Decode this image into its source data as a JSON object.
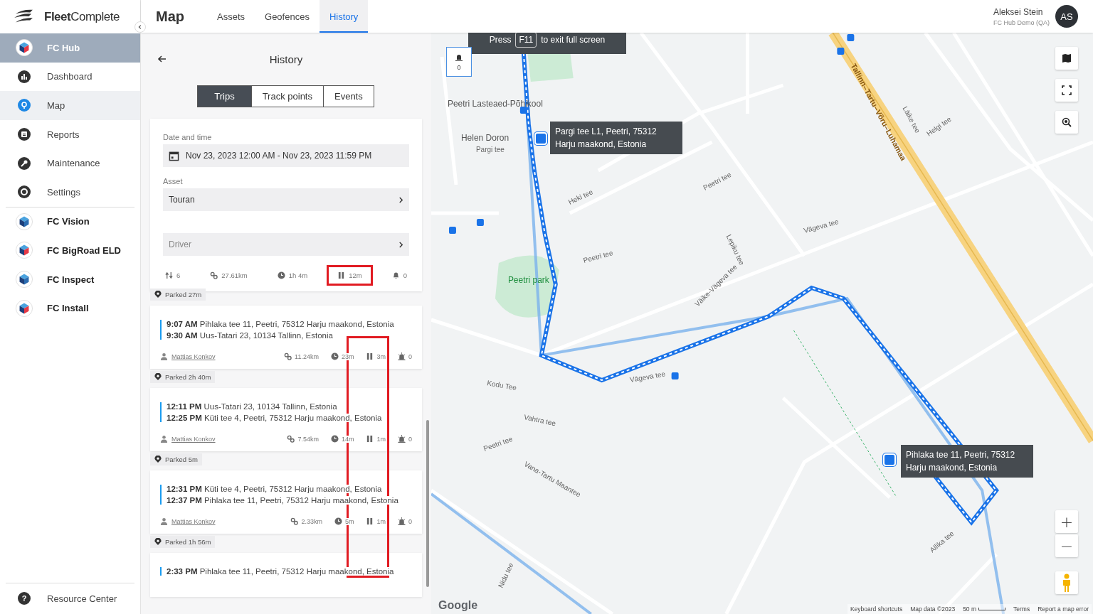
{
  "brand": {
    "bold": "Fleet",
    "light": "Complete"
  },
  "sidebar": {
    "items": [
      {
        "label": "FC Hub",
        "kind": "app",
        "selected": true
      },
      {
        "label": "Dashboard",
        "kind": "page",
        "selected": false
      },
      {
        "label": "Map",
        "kind": "page",
        "selected": true
      },
      {
        "label": "Reports",
        "kind": "page",
        "selected": false
      },
      {
        "label": "Maintenance",
        "kind": "page",
        "selected": false
      },
      {
        "label": "Settings",
        "kind": "page",
        "selected": false
      },
      {
        "label": "FC Vision",
        "kind": "app",
        "selected": false
      },
      {
        "label": "FC BigRoad ELD",
        "kind": "app",
        "selected": false
      },
      {
        "label": "FC Inspect",
        "kind": "app",
        "selected": false
      },
      {
        "label": "FC Install",
        "kind": "app",
        "selected": false
      }
    ],
    "footer_item": "Resource Center",
    "footer_icon": "?"
  },
  "header": {
    "title": "Map",
    "tabs": [
      {
        "label": "Assets",
        "selected": false
      },
      {
        "label": "Geofences",
        "selected": false
      },
      {
        "label": "History",
        "selected": true
      }
    ],
    "user": {
      "name": "Aleksei Stein",
      "org": "FC Hub Demo (QA)",
      "initials": "AS"
    }
  },
  "panel": {
    "title": "History",
    "segments": [
      {
        "label": "Trips",
        "selected": true
      },
      {
        "label": "Track points",
        "selected": false
      },
      {
        "label": "Events",
        "selected": false
      }
    ],
    "filters": {
      "date_label": "Date and time",
      "date_value": "Nov 23, 2023 12:00 AM - Nov 23, 2023 11:59 PM",
      "asset_label": "Asset",
      "asset_value": "Touran",
      "driver_placeholder": "Driver"
    },
    "summary": [
      {
        "kind": "trips",
        "value": "6",
        "highlighted": false
      },
      {
        "kind": "distance",
        "value": "27.61km",
        "highlighted": false
      },
      {
        "kind": "duration",
        "value": "1h 4m",
        "highlighted": false
      },
      {
        "kind": "idle",
        "value": "12m",
        "highlighted": true
      },
      {
        "kind": "alerts",
        "value": "0",
        "highlighted": false
      }
    ],
    "timeline_highlighted": true,
    "timeline": [
      {
        "kind": "parked",
        "label": "Parked 27m"
      },
      {
        "kind": "trip",
        "stops": [
          {
            "time": "9:07 AM",
            "address": "Pihlaka tee 11, Peetri, 75312 Harju maakond, Estonia"
          },
          {
            "time": "9:30 AM",
            "address": "Uus-Tatari 23, 10134 Tallinn, Estonia"
          }
        ],
        "driver": "Mattias Konkov",
        "stats": [
          {
            "kind": "distance",
            "value": "11.24km"
          },
          {
            "kind": "duration",
            "value": "23m"
          },
          {
            "kind": "idle",
            "value": "3m"
          },
          {
            "kind": "events",
            "value": "0"
          }
        ]
      },
      {
        "kind": "parked",
        "label": "Parked 2h 40m"
      },
      {
        "kind": "trip",
        "stops": [
          {
            "time": "12:11 PM",
            "address": "Uus-Tatari 23, 10134 Tallinn, Estonia"
          },
          {
            "time": "12:25 PM",
            "address": "Küti tee 4, Peetri, 75312 Harju maakond, Estonia"
          }
        ],
        "driver": "Mattias Konkov",
        "stats": [
          {
            "kind": "distance",
            "value": "7.54km"
          },
          {
            "kind": "duration",
            "value": "14m"
          },
          {
            "kind": "idle",
            "value": "1m"
          },
          {
            "kind": "events",
            "value": "0"
          }
        ]
      },
      {
        "kind": "parked",
        "label": "Parked 5m"
      },
      {
        "kind": "trip",
        "stops": [
          {
            "time": "12:31 PM",
            "address": "Küti tee 4, Peetri, 75312 Harju maakond, Estonia"
          },
          {
            "time": "12:37 PM",
            "address": "Pihlaka tee 11, Peetri, 75312 Harju maakond, Estonia"
          }
        ],
        "driver": "Mattias Konkov",
        "stats": [
          {
            "kind": "distance",
            "value": "2.33km"
          },
          {
            "kind": "duration",
            "value": "5m"
          },
          {
            "kind": "idle",
            "value": "1m"
          },
          {
            "kind": "events",
            "value": "0"
          }
        ]
      },
      {
        "kind": "parked",
        "label": "Parked 1h 56m"
      },
      {
        "kind": "trip",
        "stops": [
          {
            "time": "2:33 PM",
            "address": "Pihlaka tee 11, Peetri, 75312 Harju maakond, Estonia"
          }
        ]
      }
    ]
  },
  "map": {
    "fullscreen_notice": {
      "before": "Press",
      "key": "F11",
      "after": "to exit full screen"
    },
    "event_marker": {
      "count": "0"
    },
    "tooltips": [
      "Pargi tee L1, Peetri, 75312 Harju maakond, Estonia",
      "Pihlaka tee 11, Peetri, 75312 Harju maakond, Estonia"
    ],
    "places": [
      "Peetri Lasteaed-Põhikool",
      "Helen Doron",
      "Peetri park"
    ],
    "streets": [
      "Pargi tee",
      "Tallinn–Tartu–Võru–Luhamaa",
      "Helgi tee",
      "Läike tee",
      "Heki tee",
      "Peetri tee",
      "Vägeva tee",
      "Lepiku tee",
      "Väike-Vägeva tee",
      "Vägeva tee",
      "Kodu Tee",
      "Vahtra tee",
      "Peetri tee",
      "Vana-Tartu Maantee",
      "Nidu tee",
      "Allika tee",
      "Peetri tee"
    ],
    "zoom": {
      "in": "+",
      "out": "−"
    },
    "footer": {
      "logo": "Google",
      "links": [
        "Keyboard shortcuts",
        "Map data ©2023"
      ],
      "scale": "50 m",
      "links_end": [
        "Terms",
        "Report a map error"
      ]
    }
  }
}
